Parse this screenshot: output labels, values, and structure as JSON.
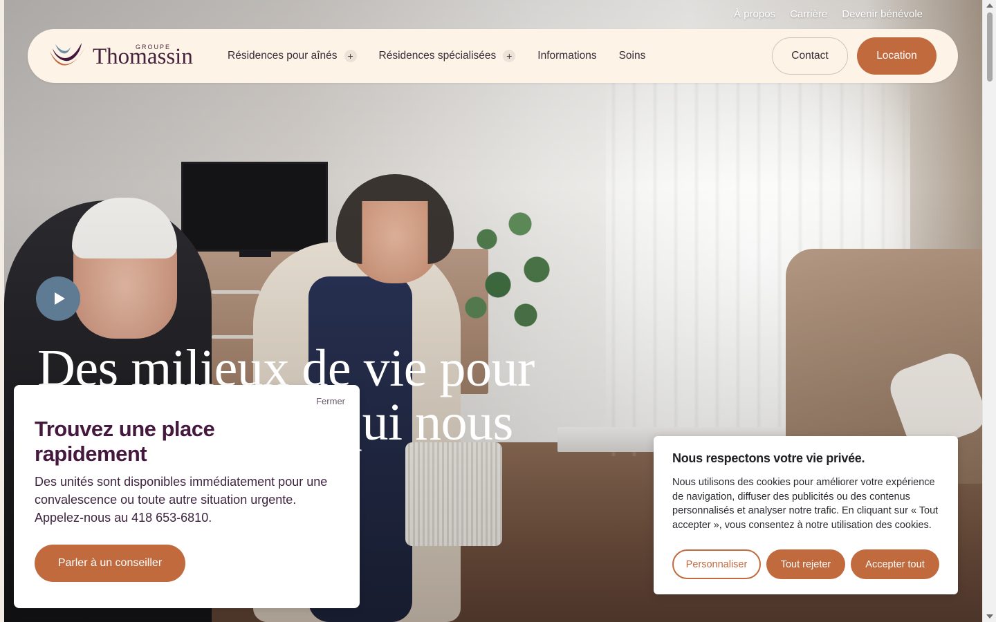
{
  "top_links": [
    "À propos",
    "Carrière",
    "Devenir bénévole"
  ],
  "logo": {
    "groupe": "GROUPE",
    "name": "Thomassin"
  },
  "nav": {
    "items": [
      {
        "label": "Résidences pour aînés",
        "expandable": true
      },
      {
        "label": "Résidences spécialisées",
        "expandable": true
      },
      {
        "label": "Informations",
        "expandable": false
      },
      {
        "label": "Soins",
        "expandable": false
      }
    ],
    "contact_label": "Contact",
    "location_label": "Location"
  },
  "hero": {
    "headline_line1": "Des milieux de vie pour",
    "headline_line2": "ceux qui nous"
  },
  "card": {
    "close_label": "Fermer",
    "title": "Trouvez une place rapidement",
    "text": "Des unités sont disponibles immédiatement pour une convalescence ou toute autre situation urgente. Appelez-nous au 418 653-6810.",
    "button_label": "Parler à un conseiller"
  },
  "cookie": {
    "title": "Nous respectons votre vie privée.",
    "text": "Nous utilisons des cookies pour améliorer votre expérience de navigation, diffuser des publicités ou des contenus personnalisés et analyser notre trafic. En cliquant sur « Tout accepter », vous consentez à notre utilisation des cookies.",
    "customize_label": "Personnaliser",
    "reject_label": "Tout rejeter",
    "accept_label": "Accepter tout"
  },
  "colors": {
    "accent": "#c06a3e",
    "nav_bg": "#fdf3e6",
    "brand_purple": "#45183e",
    "play_bg": "#5f7a93"
  },
  "icons": {
    "play": "play-icon",
    "plus": "plus-icon"
  }
}
